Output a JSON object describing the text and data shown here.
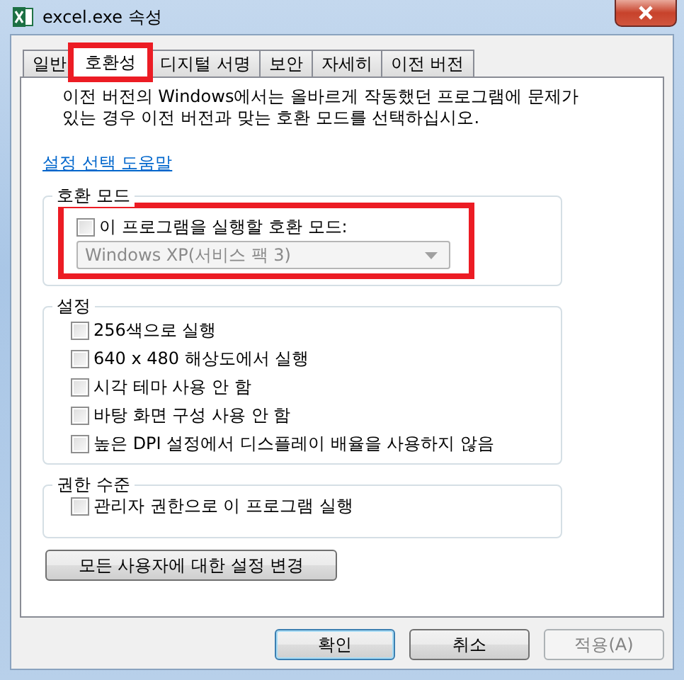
{
  "window": {
    "title": "excel.exe 속성"
  },
  "tabs": [
    {
      "label": "일반",
      "selected": false,
      "highlighted": false
    },
    {
      "label": "호환성",
      "selected": true,
      "highlighted": true
    },
    {
      "label": "디지털 서명",
      "selected": false,
      "highlighted": false
    },
    {
      "label": "보안",
      "selected": false,
      "highlighted": false
    },
    {
      "label": "자세히",
      "selected": false,
      "highlighted": false
    },
    {
      "label": "이전 버전",
      "selected": false,
      "highlighted": false
    }
  ],
  "description": "이전 버전의 Windows에서는 올바르게 작동했던 프로그램에 문제가\n있는 경우 이전 버전과 맞는 호환 모드를 선택하십시오.",
  "help_link": "설정 선택 도움말",
  "compat_mode": {
    "title": "호환 모드",
    "highlighted": true,
    "checkbox": {
      "label": "이 프로그램을 실행할 호환 모드:",
      "checked": false
    },
    "dropdown": {
      "value": "Windows XP(서비스 팩 3)",
      "disabled": true
    }
  },
  "settings": {
    "title": "설정",
    "options": [
      {
        "label": "256색으로 실행",
        "checked": false
      },
      {
        "label": "640 x 480 해상도에서 실행",
        "checked": false
      },
      {
        "label": "시각 테마 사용 안 함",
        "checked": false
      },
      {
        "label": "바탕 화면 구성 사용 안 함",
        "checked": false
      },
      {
        "label": "높은 DPI 설정에서 디스플레이 배율을 사용하지 않음",
        "checked": false
      }
    ]
  },
  "privilege": {
    "title": "권한 수준",
    "options": [
      {
        "label": "관리자 권한으로 이 프로그램 실행",
        "checked": false
      }
    ]
  },
  "all_users_button": "모든 사용자에 대한 설정 변경",
  "buttons": [
    {
      "label": "확인",
      "default": true,
      "disabled": false
    },
    {
      "label": "취소",
      "default": false,
      "disabled": false
    },
    {
      "label": "적용(A)",
      "default": false,
      "disabled": true
    }
  ]
}
